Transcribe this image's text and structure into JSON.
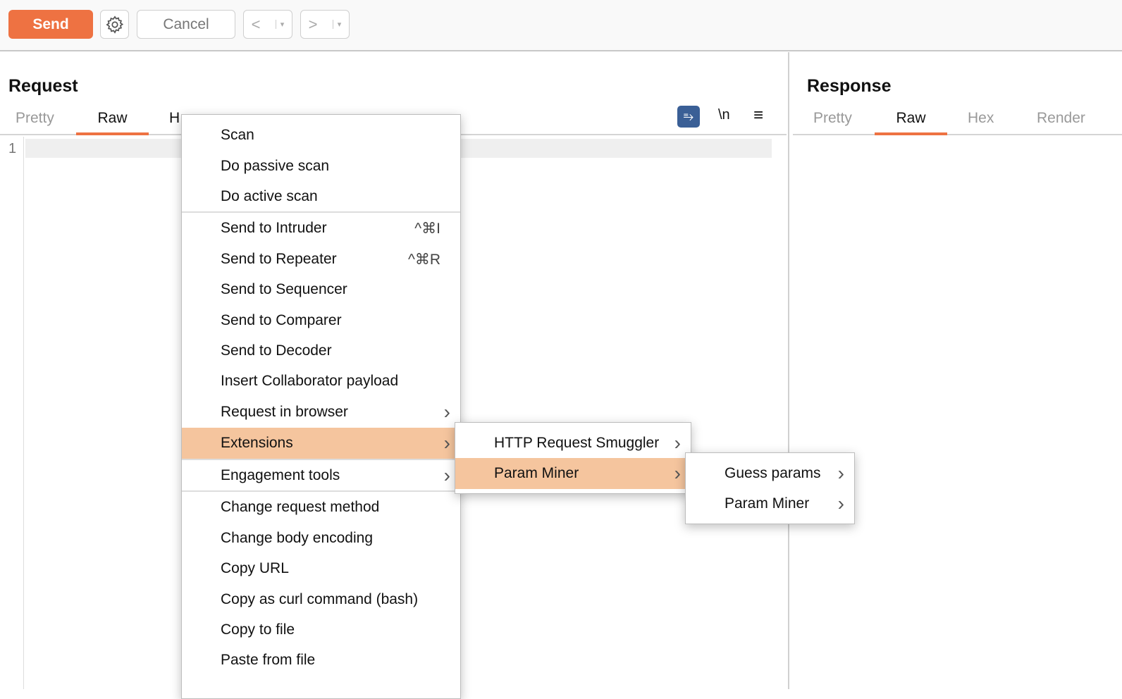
{
  "toolbar": {
    "send": "Send",
    "cancel": "Cancel",
    "back": "<",
    "forward": ">",
    "dropdown": "▾"
  },
  "request": {
    "title": "Request",
    "tabs": [
      "Pretty",
      "Raw",
      "H"
    ],
    "active_tab": "Raw",
    "line_number": "1",
    "wrap_icon": "word-wrap-icon",
    "newline_toggle": "\\n",
    "menu_icon": "≡"
  },
  "response": {
    "title": "Response",
    "tabs": [
      "Pretty",
      "Raw",
      "Hex",
      "Render"
    ],
    "active_tab": "Raw"
  },
  "context_menu": {
    "items": [
      {
        "label": "Scan"
      },
      {
        "label": "Do passive scan"
      },
      {
        "label": "Do active scan"
      },
      {
        "label": "Send to Intruder",
        "shortcut": "^⌘I"
      },
      {
        "label": "Send to Repeater",
        "shortcut": "^⌘R"
      },
      {
        "label": "Send to Sequencer"
      },
      {
        "label": "Send to Comparer"
      },
      {
        "label": "Send to Decoder"
      },
      {
        "label": "Insert Collaborator payload"
      },
      {
        "label": "Request in browser",
        "submenu": true
      },
      {
        "label": "Extensions",
        "submenu": true,
        "highlighted": true
      },
      {
        "label": "Engagement tools",
        "submenu": true
      },
      {
        "label": "Change request method"
      },
      {
        "label": "Change body encoding"
      },
      {
        "label": "Copy URL"
      },
      {
        "label": "Copy as curl command (bash)"
      },
      {
        "label": "Copy to file"
      },
      {
        "label": "Paste from file"
      }
    ]
  },
  "extensions_menu": {
    "items": [
      {
        "label": "HTTP Request Smuggler"
      },
      {
        "label": "Param Miner",
        "highlighted": true
      }
    ]
  },
  "param_miner_menu": {
    "items": [
      {
        "label": "Guess params"
      },
      {
        "label": "Param Miner"
      }
    ]
  },
  "colors": {
    "accent": "#ee7242",
    "highlight": "#f5c59e",
    "wrap_button": "#3a5f96"
  }
}
